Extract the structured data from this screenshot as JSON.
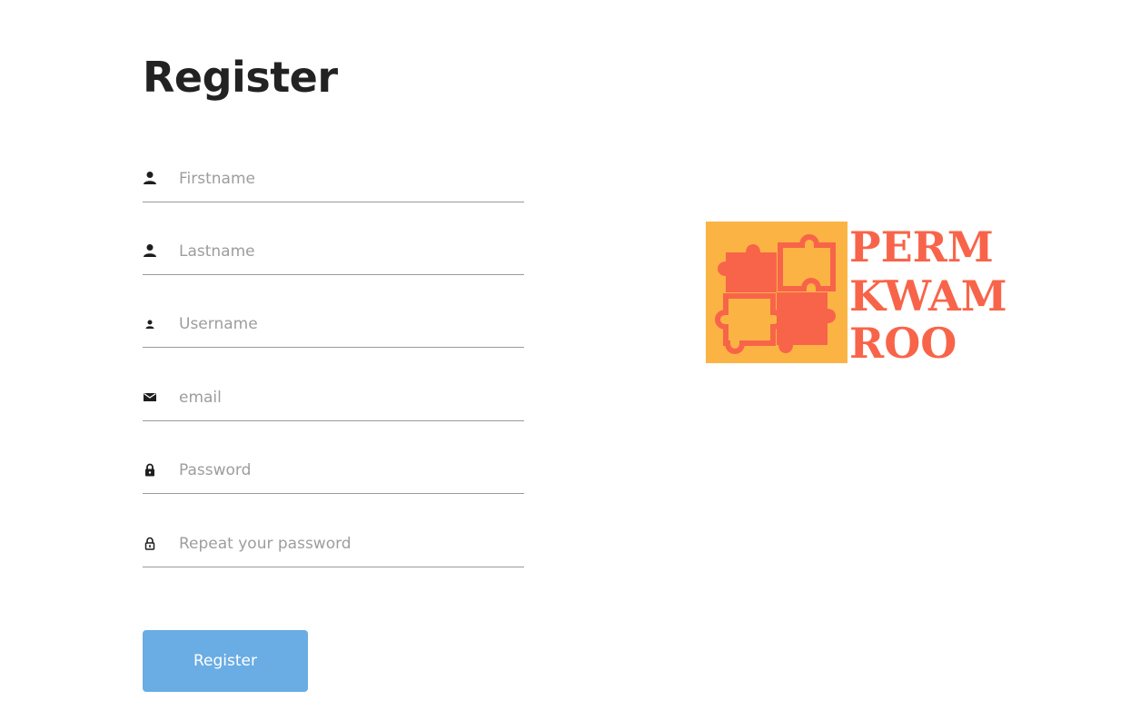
{
  "page": {
    "title": "Register"
  },
  "form": {
    "fields": [
      {
        "placeholder": "Firstname",
        "icon": "person-icon"
      },
      {
        "placeholder": "Lastname",
        "icon": "person-icon"
      },
      {
        "placeholder": "Username",
        "icon": "person-small-icon"
      },
      {
        "placeholder": "email",
        "icon": "envelope-icon"
      },
      {
        "placeholder": "Password",
        "icon": "lock-icon"
      },
      {
        "placeholder": "Repeat your password",
        "icon": "lock-outline-icon"
      }
    ],
    "submit_label": "Register"
  },
  "logo": {
    "lines": [
      "PERM",
      "KWAM",
      "ROO"
    ],
    "colors": {
      "background": "#fbb444",
      "piece": "#f8644a",
      "text": "#f8644a"
    }
  },
  "colors": {
    "button": "#6aace4",
    "underline": "#9a9a9a",
    "title": "#222222"
  }
}
